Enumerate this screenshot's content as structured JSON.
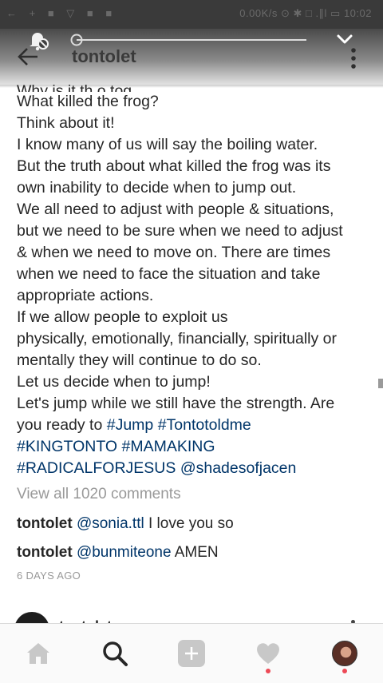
{
  "status_bar": {
    "left_icons_text": "← + ■ ▽ ■ ■",
    "right_text": "0.00K/s ⊙ ✱ □ .∥l ▭ 10:02"
  },
  "header": {
    "username": "tontolet",
    "media_progress": 0.0
  },
  "post": {
    "caption_clipped": "Why is it th o tog",
    "caption_lines": [
      "What killed the frog?",
      "Think about it!",
      "I know many of us will say the boiling water.",
      "But the truth about what killed the frog was its",
      "own inability to decide when to jump out.",
      "We all need to adjust with people & situations,",
      "but we need to be sure when we need to adjust",
      "& when we need to move on. There are times",
      "when we need to face the situation and take",
      "appropriate actions.",
      "If we allow people to exploit us",
      "physically, emotionally, financially, spiritually or",
      "mentally they will continue to do so.",
      "Let us decide when to jump!",
      "Let's jump while we still have the strength. Are"
    ],
    "caption_tag_line_1": {
      "prefix": "you ready to ",
      "tag1": "#Jump",
      "tag2": "#Tontotoldme"
    },
    "caption_tag_line_2": {
      "tag1": "#KINGTONTO",
      "tag2": "#MAMAKING"
    },
    "caption_tag_line_3": {
      "tag1": "#RADICALFORJESUS",
      "tag2": "@shadesofjacen"
    },
    "view_all_comments": "View all 1020 comments",
    "comments": [
      {
        "user": "tontolet",
        "mention": "@sonia.ttl",
        "text": " I love you so"
      },
      {
        "user": "tontolet",
        "mention": "@bunmiteone",
        "text": " AMEN"
      }
    ],
    "timestamp": "6 DAYS AGO"
  },
  "next_post": {
    "username": "tontolet"
  },
  "tab_bar": {
    "tabs": [
      {
        "name": "home",
        "icon": "home-icon",
        "active": false
      },
      {
        "name": "search",
        "icon": "search-icon",
        "active": true
      },
      {
        "name": "add",
        "icon": "add-post-icon",
        "active": false
      },
      {
        "name": "activity",
        "icon": "heart-icon",
        "active": false,
        "notification": true
      },
      {
        "name": "profile",
        "icon": "profile-avatar",
        "active": false,
        "notification": true
      }
    ]
  },
  "colors": {
    "tag_link": "#003569",
    "muted_text": "#999999",
    "notification_dot": "#ed4956"
  }
}
